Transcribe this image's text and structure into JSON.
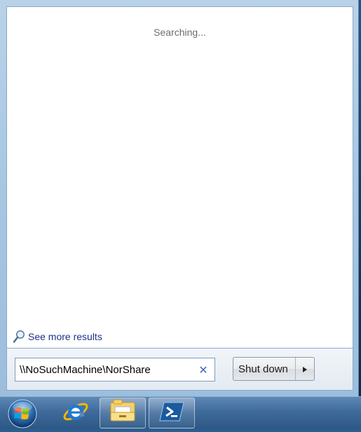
{
  "start_menu": {
    "status_text": "Searching...",
    "see_more_label": "See more results",
    "search_value": "\\\\NoSuchMachine\\NorShare",
    "clear_icon": "✕",
    "shutdown_label": "Shut down"
  },
  "taskbar": {
    "items": [
      {
        "icon": "windows-orb-icon"
      },
      {
        "icon": "internet-explorer-icon"
      },
      {
        "icon": "windows-explorer-icon"
      },
      {
        "icon": "powershell-icon"
      }
    ]
  },
  "colors": {
    "link": "#1e3287",
    "clear": "#3d6fb4",
    "status": "#6d6d6d"
  }
}
